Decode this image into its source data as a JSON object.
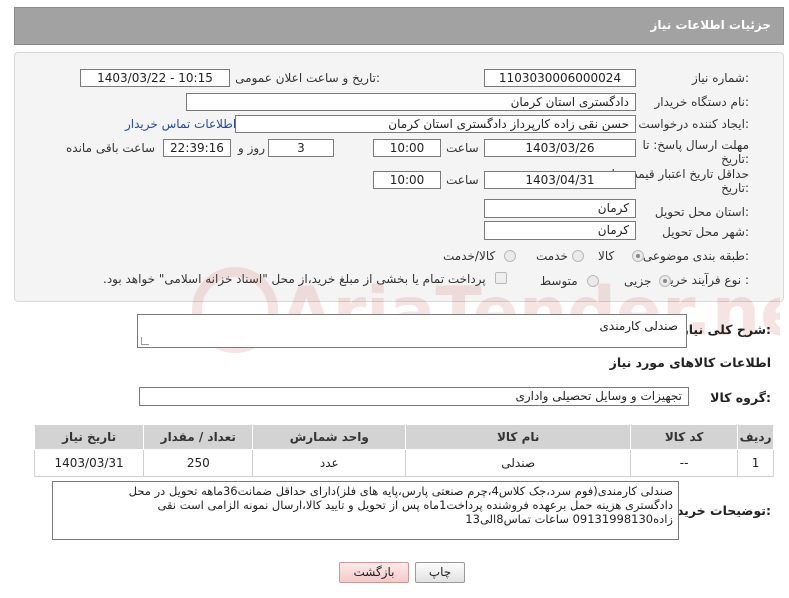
{
  "header": {
    "title": "جزئیات اطلاعات نیاز"
  },
  "form": {
    "need_number": {
      "label": "شماره نیاز:",
      "value": "1103030006000024"
    },
    "announce_datetime": {
      "label": "تاریخ و ساعت اعلان عمومی:",
      "value": "1403/03/22 - 10:15"
    },
    "buyer_org": {
      "label": "نام دستگاه خریدار:",
      "value": "دادگستری استان کرمان"
    },
    "requester": {
      "label": "ایجاد کننده درخواست:",
      "value": "حسن نقی زاده کارپرداز دادگستری استان کرمان",
      "contact_link": "اطلاعات تماس خریدار"
    },
    "reply_deadline": {
      "label_line1": "مهلت ارسال پاسخ: تا",
      "label_line2": "تاریخ:",
      "date": "1403/03/26",
      "time_label": "ساعت",
      "time": "10:00",
      "days": "3",
      "days_label": "روز و",
      "remaining_time": "22:39:16",
      "remaining_label": "ساعت باقی مانده"
    },
    "price_validity": {
      "label_line1": "حداقل تاریخ اعتبار قیمت: تا",
      "label_line2": "تاریخ:",
      "date": "1403/04/31",
      "time_label": "ساعت",
      "time": "10:00"
    },
    "delivery_province": {
      "label": "استان محل تحویل:",
      "value": "کرمان"
    },
    "delivery_city": {
      "label": "شهر محل تحویل:",
      "value": "کرمان"
    },
    "category": {
      "label": "طبقه بندی موضوعی:",
      "options": [
        "کالا",
        "خدمت",
        "کالا/خدمت"
      ],
      "selected": "کالا"
    },
    "purchase_process": {
      "label": "نوع فرآیند خرید :",
      "options": [
        "جزیی",
        "متوسط"
      ],
      "selected": "جزیی",
      "payment_note": "پرداخت تمام یا بخشی از مبلغ خرید،از محل \"اسناد خزانه اسلامی\" خواهد بود."
    }
  },
  "summary": {
    "label": "شرح کلی نیاز:",
    "value": "صندلی کارمندی"
  },
  "goods_section": {
    "title": "اطلاعات کالاهای مورد نیاز",
    "group_label": "گروه کالا:",
    "group_value": "تجهیزات و وسایل تحصیلی واداری"
  },
  "table": {
    "headers": [
      "ردیف",
      "کد کالا",
      "نام کالا",
      "واحد شمارش",
      "تعداد / مقدار",
      "تاریخ نیاز"
    ],
    "rows": [
      [
        "1",
        "--",
        "صندلی",
        "عدد",
        "250",
        "1403/03/31"
      ]
    ]
  },
  "buyer_notes": {
    "label": "توضیحات خریدار:",
    "line1": "صندلی کارمندی(فوم سرد،جک کلاس4،چرم صنعتی پارس،پایه های فلز)دارای حداقل ضمانت36ماهه تحویل در محل",
    "line2": "دادگستری هزینه حمل برعهده فروشنده پرداخت1ماه پس از تحویل و تایید کالا،ارسال نمونه الزامی است نقی",
    "line3": "زاده09131998130 ساعات تماس8الی13"
  },
  "buttons": {
    "print": "چاپ",
    "back": "بازگشت"
  },
  "watermark": {
    "text": "AriaTender.neT"
  }
}
